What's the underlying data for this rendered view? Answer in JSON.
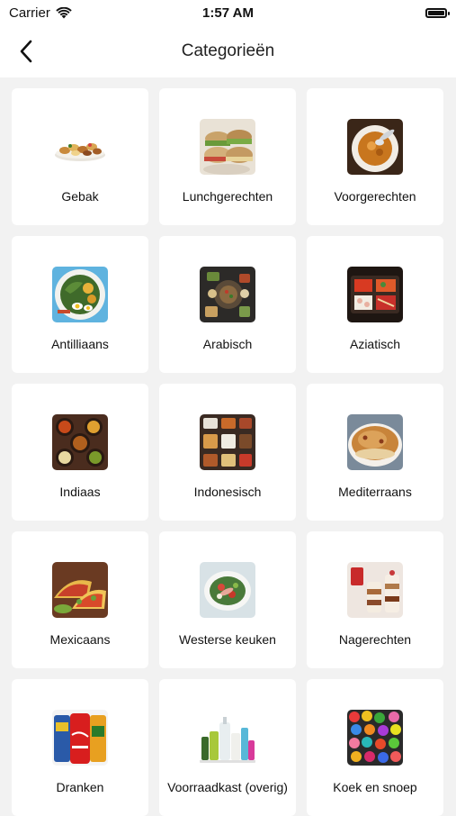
{
  "status_bar": {
    "carrier": "Carrier",
    "time": "1:57 AM"
  },
  "header": {
    "title": "Categorieën",
    "back_icon": "chevron-left-icon"
  },
  "categories": [
    {
      "label": "Gebak"
    },
    {
      "label": "Lunchgerechten"
    },
    {
      "label": "Voorgerechten"
    },
    {
      "label": "Antilliaans"
    },
    {
      "label": "Arabisch"
    },
    {
      "label": "Aziatisch"
    },
    {
      "label": "Indiaas"
    },
    {
      "label": "Indonesisch"
    },
    {
      "label": "Mediterraans"
    },
    {
      "label": "Mexicaans"
    },
    {
      "label": "Westerse keuken"
    },
    {
      "label": "Nagerechten"
    },
    {
      "label": "Dranken"
    },
    {
      "label": "Voorraadkast (overig)"
    },
    {
      "label": "Koek en snoep"
    }
  ]
}
